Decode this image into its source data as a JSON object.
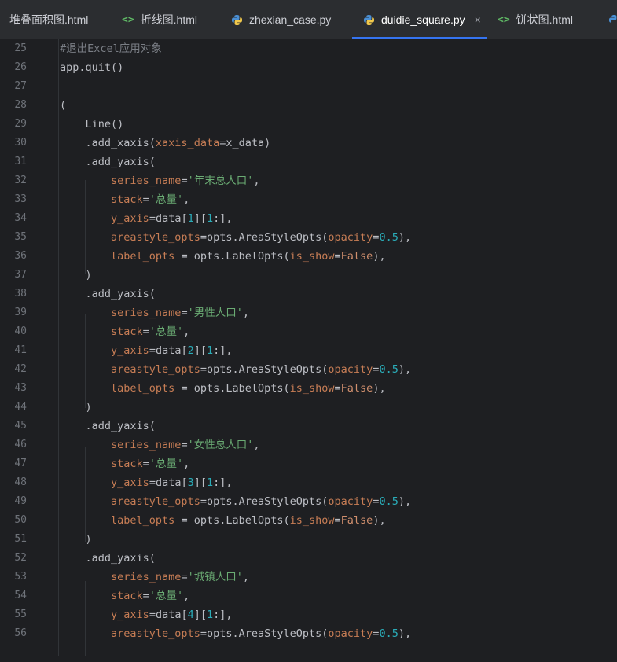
{
  "tabs": [
    {
      "label": "堆叠面积图.html",
      "type": "html",
      "active": false
    },
    {
      "label": "折线图.html",
      "type": "html",
      "active": false
    },
    {
      "label": "zhexian_case.py",
      "type": "python",
      "active": false
    },
    {
      "label": "duidie_square.py",
      "type": "python",
      "active": true
    },
    {
      "label": "饼状图.html",
      "type": "html",
      "active": false
    }
  ],
  "icons": {
    "html": "<>",
    "close": "×"
  },
  "colors": {
    "background": "#1e1f22",
    "tabbar": "#2b2d30",
    "active_tab_underline": "#3574f0",
    "comment": "#7a7e85",
    "keyword_arg": "#c77d55",
    "string": "#6aab73",
    "number": "#2aacb8",
    "keyword": "#cf8e6d",
    "text": "#bcbec4"
  },
  "lines": [
    {
      "n": "25",
      "tokens": [
        [
          "c",
          "#退出Excel应用对象"
        ]
      ]
    },
    {
      "n": "26",
      "tokens": [
        [
          "p",
          "app.quit()"
        ]
      ]
    },
    {
      "n": "27",
      "tokens": []
    },
    {
      "n": "28",
      "tokens": [
        [
          "p",
          "("
        ]
      ]
    },
    {
      "n": "29",
      "tokens": [
        [
          "p",
          "    Line()"
        ]
      ]
    },
    {
      "n": "30",
      "tokens": [
        [
          "p",
          "    .add_xaxis("
        ],
        [
          "a",
          "xaxis_data"
        ],
        [
          "p",
          "=x_data)"
        ]
      ]
    },
    {
      "n": "31",
      "tokens": [
        [
          "p",
          "    .add_yaxis("
        ]
      ]
    },
    {
      "n": "32",
      "tokens": [
        [
          "p",
          "        "
        ],
        [
          "a",
          "series_name"
        ],
        [
          "p",
          "="
        ],
        [
          "s",
          "'年末总人口'"
        ],
        [
          "p",
          ","
        ]
      ]
    },
    {
      "n": "33",
      "tokens": [
        [
          "p",
          "        "
        ],
        [
          "a",
          "stack"
        ],
        [
          "p",
          "="
        ],
        [
          "s",
          "'总量'"
        ],
        [
          "p",
          ","
        ]
      ]
    },
    {
      "n": "34",
      "tokens": [
        [
          "p",
          "        "
        ],
        [
          "a",
          "y_axis"
        ],
        [
          "p",
          "=data["
        ],
        [
          "n",
          "1"
        ],
        [
          "p",
          "]["
        ],
        [
          "n",
          "1"
        ],
        [
          "p",
          ":],"
        ]
      ]
    },
    {
      "n": "35",
      "tokens": [
        [
          "p",
          "        "
        ],
        [
          "a",
          "areastyle_opts"
        ],
        [
          "p",
          "=opts.AreaStyleOpts("
        ],
        [
          "a",
          "opacity"
        ],
        [
          "p",
          "="
        ],
        [
          "n",
          "0.5"
        ],
        [
          "p",
          "),"
        ]
      ]
    },
    {
      "n": "36",
      "tokens": [
        [
          "p",
          "        "
        ],
        [
          "a",
          "label_opts"
        ],
        [
          "p",
          " = opts.LabelOpts("
        ],
        [
          "a",
          "is_show"
        ],
        [
          "p",
          "="
        ],
        [
          "k",
          "False"
        ],
        [
          "p",
          "),"
        ]
      ]
    },
    {
      "n": "37",
      "tokens": [
        [
          "p",
          "    )"
        ]
      ]
    },
    {
      "n": "38",
      "tokens": [
        [
          "p",
          "    .add_yaxis("
        ]
      ]
    },
    {
      "n": "39",
      "tokens": [
        [
          "p",
          "        "
        ],
        [
          "a",
          "series_name"
        ],
        [
          "p",
          "="
        ],
        [
          "s",
          "'男性人口'"
        ],
        [
          "p",
          ","
        ]
      ]
    },
    {
      "n": "40",
      "tokens": [
        [
          "p",
          "        "
        ],
        [
          "a",
          "stack"
        ],
        [
          "p",
          "="
        ],
        [
          "s",
          "'总量'"
        ],
        [
          "p",
          ","
        ]
      ]
    },
    {
      "n": "41",
      "tokens": [
        [
          "p",
          "        "
        ],
        [
          "a",
          "y_axis"
        ],
        [
          "p",
          "=data["
        ],
        [
          "n",
          "2"
        ],
        [
          "p",
          "]["
        ],
        [
          "n",
          "1"
        ],
        [
          "p",
          ":],"
        ]
      ]
    },
    {
      "n": "42",
      "tokens": [
        [
          "p",
          "        "
        ],
        [
          "a",
          "areastyle_opts"
        ],
        [
          "p",
          "=opts.AreaStyleOpts("
        ],
        [
          "a",
          "opacity"
        ],
        [
          "p",
          "="
        ],
        [
          "n",
          "0.5"
        ],
        [
          "p",
          "),"
        ]
      ]
    },
    {
      "n": "43",
      "tokens": [
        [
          "p",
          "        "
        ],
        [
          "a",
          "label_opts"
        ],
        [
          "p",
          " = opts.LabelOpts("
        ],
        [
          "a",
          "is_show"
        ],
        [
          "p",
          "="
        ],
        [
          "k",
          "False"
        ],
        [
          "p",
          "),"
        ]
      ]
    },
    {
      "n": "44",
      "tokens": [
        [
          "p",
          "    )"
        ]
      ]
    },
    {
      "n": "45",
      "tokens": [
        [
          "p",
          "    .add_yaxis("
        ]
      ]
    },
    {
      "n": "46",
      "tokens": [
        [
          "p",
          "        "
        ],
        [
          "a",
          "series_name"
        ],
        [
          "p",
          "="
        ],
        [
          "s",
          "'女性总人口'"
        ],
        [
          "p",
          ","
        ]
      ]
    },
    {
      "n": "47",
      "tokens": [
        [
          "p",
          "        "
        ],
        [
          "a",
          "stack"
        ],
        [
          "p",
          "="
        ],
        [
          "s",
          "'总量'"
        ],
        [
          "p",
          ","
        ]
      ]
    },
    {
      "n": "48",
      "tokens": [
        [
          "p",
          "        "
        ],
        [
          "a",
          "y_axis"
        ],
        [
          "p",
          "=data["
        ],
        [
          "n",
          "3"
        ],
        [
          "p",
          "]["
        ],
        [
          "n",
          "1"
        ],
        [
          "p",
          ":],"
        ]
      ]
    },
    {
      "n": "49",
      "tokens": [
        [
          "p",
          "        "
        ],
        [
          "a",
          "areastyle_opts"
        ],
        [
          "p",
          "=opts.AreaStyleOpts("
        ],
        [
          "a",
          "opacity"
        ],
        [
          "p",
          "="
        ],
        [
          "n",
          "0.5"
        ],
        [
          "p",
          "),"
        ]
      ]
    },
    {
      "n": "50",
      "tokens": [
        [
          "p",
          "        "
        ],
        [
          "a",
          "label_opts"
        ],
        [
          "p",
          " = opts.LabelOpts("
        ],
        [
          "a",
          "is_show"
        ],
        [
          "p",
          "="
        ],
        [
          "k",
          "False"
        ],
        [
          "p",
          "),"
        ]
      ]
    },
    {
      "n": "51",
      "tokens": [
        [
          "p",
          "    )"
        ]
      ]
    },
    {
      "n": "52",
      "tokens": [
        [
          "p",
          "    .add_yaxis("
        ]
      ]
    },
    {
      "n": "53",
      "tokens": [
        [
          "p",
          "        "
        ],
        [
          "a",
          "series_name"
        ],
        [
          "p",
          "="
        ],
        [
          "s",
          "'城镇人口'"
        ],
        [
          "p",
          ","
        ]
      ]
    },
    {
      "n": "54",
      "tokens": [
        [
          "p",
          "        "
        ],
        [
          "a",
          "stack"
        ],
        [
          "p",
          "="
        ],
        [
          "s",
          "'总量'"
        ],
        [
          "p",
          ","
        ]
      ]
    },
    {
      "n": "55",
      "tokens": [
        [
          "p",
          "        "
        ],
        [
          "a",
          "y_axis"
        ],
        [
          "p",
          "=data["
        ],
        [
          "n",
          "4"
        ],
        [
          "p",
          "]["
        ],
        [
          "n",
          "1"
        ],
        [
          "p",
          ":],"
        ]
      ]
    },
    {
      "n": "56",
      "tokens": [
        [
          "p",
          "        "
        ],
        [
          "a",
          "areastyle_opts"
        ],
        [
          "p",
          "=opts.AreaStyleOpts("
        ],
        [
          "a",
          "opacity"
        ],
        [
          "p",
          "="
        ],
        [
          "n",
          "0.5"
        ],
        [
          "p",
          "),"
        ]
      ]
    }
  ]
}
